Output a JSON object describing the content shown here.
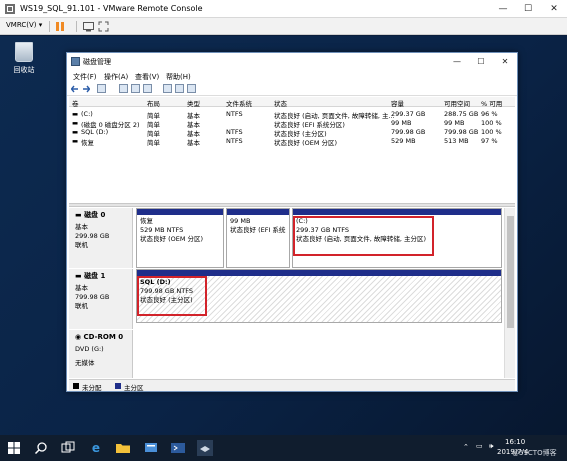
{
  "vmrc": {
    "title": "WS19_SQL_91.101 - VMware Remote Console",
    "menu_label": "VMRC(V)",
    "menu_arrow": "▾"
  },
  "desktop": {
    "recycle_bin_label": "回收站"
  },
  "disk_mgmt": {
    "title": "磁盘管理",
    "menu": [
      "文件(F)",
      "操作(A)",
      "查看(V)",
      "帮助(H)"
    ],
    "columns": [
      "卷",
      "布局",
      "类型",
      "文件系统",
      "状态",
      "容量",
      "可用空间",
      "% 可用"
    ],
    "volumes": [
      [
        "(C:)",
        "简单",
        "基本",
        "NTFS",
        "状态良好 (启动, 页面文件, 故障转储, 主...",
        "299.37 GB",
        "288.75 GB",
        "96 %"
      ],
      [
        "(磁盘 0 磁盘分区 2)",
        "简单",
        "基本",
        "",
        "状态良好 (EFI 系统分区)",
        "99 MB",
        "99 MB",
        "100 %"
      ],
      [
        "SQL (D:)",
        "简单",
        "基本",
        "NTFS",
        "状态良好 (主分区)",
        "799.98 GB",
        "799.98 GB",
        "100 %"
      ],
      [
        "恢复",
        "简单",
        "基本",
        "NTFS",
        "状态良好 (OEM 分区)",
        "529 MB",
        "513 MB",
        "97 %"
      ]
    ],
    "disks": [
      {
        "name": "磁盘 0",
        "type": "基本",
        "size": "299.98 GB",
        "status": "联机",
        "partitions": [
          {
            "name": "恢复",
            "size": "529 MB NTFS",
            "status": "状态良好 (OEM 分区)"
          },
          {
            "name": "",
            "size": "99 MB",
            "status": "状态良好 (EFI 系统分区)"
          },
          {
            "name": "(C:)",
            "size": "299.37 GB NTFS",
            "status": "状态良好 (启动, 页面文件, 故障转储, 主分区)"
          }
        ]
      },
      {
        "name": "磁盘 1",
        "type": "基本",
        "size": "799.98 GB",
        "status": "联机",
        "partitions": [
          {
            "name": "SQL  (D:)",
            "size": "799.98 GB NTFS",
            "status": "状态良好 (主分区)"
          }
        ]
      },
      {
        "name": "CD-ROM 0",
        "type": "DVD (G:)",
        "size": "",
        "status": "无媒体"
      }
    ],
    "legend": [
      "未分配",
      "主分区"
    ],
    "colors": {
      "unallocated": "#000000",
      "primary": "#1f2e8a",
      "highlight": "#d2232a"
    }
  },
  "taskbar": {
    "time": "16:10",
    "date": "2019/7/4",
    "watermark": "@51CTO博客"
  }
}
